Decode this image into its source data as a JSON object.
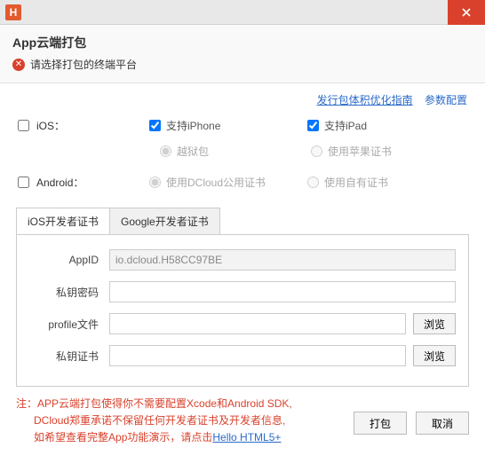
{
  "titlebar": {
    "logo": "H"
  },
  "header": {
    "title": "App云端打包",
    "error": "请选择打包的终端平台"
  },
  "links": {
    "guide": "发行包体积优化指南",
    "params": "参数配置"
  },
  "ios": {
    "label": "iOS：",
    "iphone": "支持iPhone",
    "ipad": "支持iPad",
    "jailbreak": "越狱包",
    "applecert": "使用苹果证书"
  },
  "android": {
    "label": "Android：",
    "dcloudcert": "使用DCloud公用证书",
    "owncert": "使用自有证书"
  },
  "tabs": {
    "ios": "iOS开发者证书",
    "google": "Google开发者证书"
  },
  "form": {
    "appid_label": "AppID",
    "appid_value": "io.dcloud.H58CC97BE",
    "keypwd_label": "私钥密码",
    "profile_label": "profile文件",
    "keycert_label": "私钥证书",
    "browse": "浏览"
  },
  "footer": {
    "note_prefix": "注：",
    "note_l1": "APP云端打包使得你不需要配置Xcode和Android SDK,",
    "note_l2": "DCloud郑重承诺不保留任何开发者证书及开发者信息,",
    "note_l3a": "如希望查看完整App功能演示，请点击",
    "note_link": "Hello HTML5+",
    "pack": "打包",
    "cancel": "取消"
  }
}
